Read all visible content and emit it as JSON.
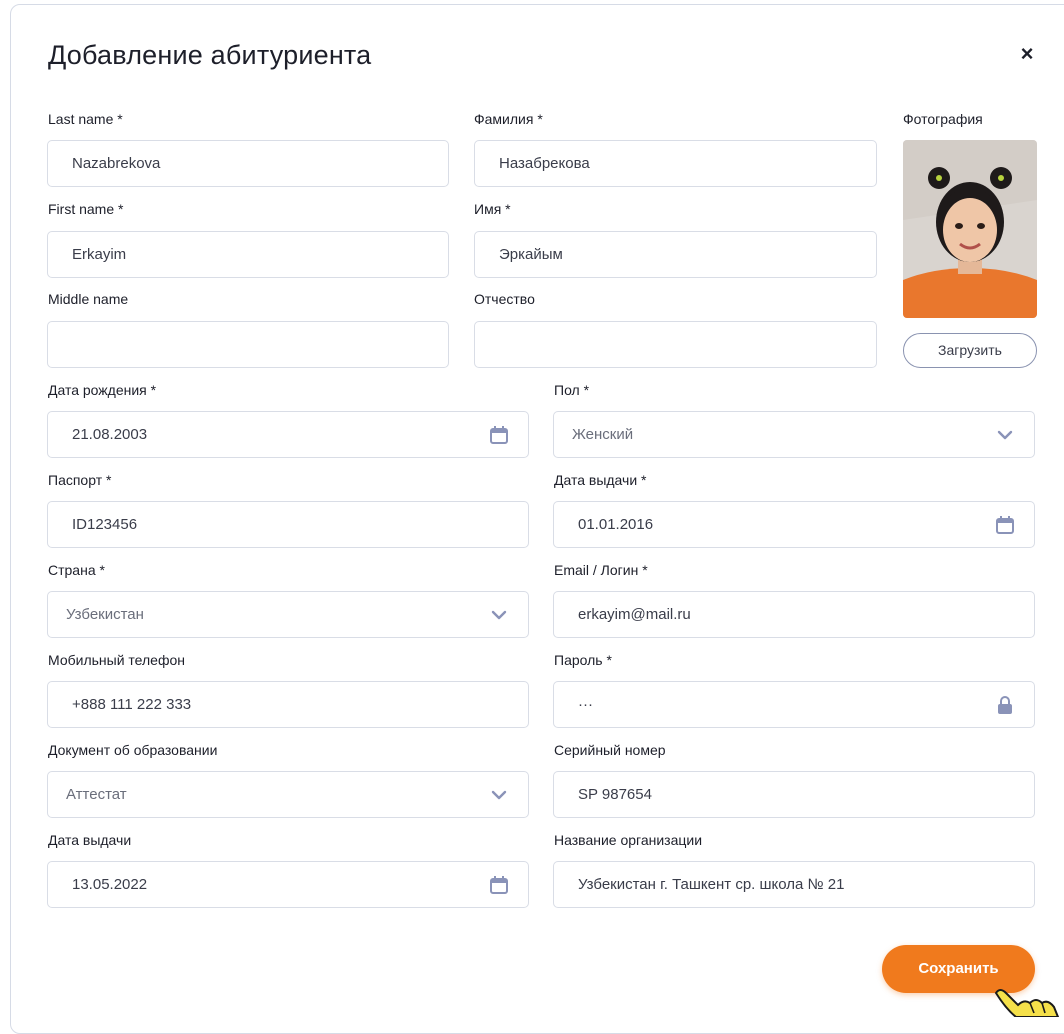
{
  "dialog": {
    "title": "Добавление абитуриента",
    "close_icon": "close-icon",
    "close_glyph": "×"
  },
  "fields": {
    "last_name": {
      "label": "Last name *",
      "value": "Nazabrekova"
    },
    "familiya": {
      "label": "Фамилия *",
      "value": "Назабрекова"
    },
    "first_name": {
      "label": "First name *",
      "value": "Erkayim"
    },
    "imya": {
      "label": "Имя *",
      "value": "Эркайым"
    },
    "middle_name": {
      "label": "Middle name",
      "value": ""
    },
    "otchestvo": {
      "label": "Отчество",
      "value": ""
    },
    "birth_date": {
      "label": "Дата рождения *",
      "value": "21.08.2003",
      "icon": "calendar-icon"
    },
    "gender": {
      "label": "Пол *",
      "value": "Женский",
      "icon": "chevron-down-icon"
    },
    "passport": {
      "label": "Паспорт *",
      "value": "ID123456"
    },
    "issue_date": {
      "label": "Дата выдачи *",
      "value": "01.01.2016",
      "icon": "calendar-icon"
    },
    "country": {
      "label": "Страна *",
      "value": "Узбекистан",
      "icon": "chevron-down-icon"
    },
    "email": {
      "label": "Email / Логин *",
      "value": "erkayim@mail.ru"
    },
    "phone": {
      "label": "Мобильный телефон",
      "value": "+888 111 222 333"
    },
    "password": {
      "label": "Пароль *",
      "value": "···",
      "icon": "lock-icon"
    },
    "edu_doc": {
      "label": "Документ об образовании",
      "value": "Аттестат",
      "icon": "chevron-down-icon"
    },
    "serial": {
      "label": "Серийный номер",
      "value": "SP 987654"
    },
    "edu_date": {
      "label": "Дата выдачи",
      "value": "13.05.2022",
      "icon": "calendar-icon"
    },
    "org_name": {
      "label": "Название организации",
      "value": "Узбекистан г. Ташкент  ср. школа № 21"
    }
  },
  "photo": {
    "label": "Фотография",
    "upload_label": "Загрузить"
  },
  "actions": {
    "save_label": "Сохранить",
    "cursor_icon": "hand-pointer-icon"
  },
  "colors": {
    "accent": "#f07a1d",
    "icon": "#8a93b8",
    "border": "#d9dde6"
  }
}
